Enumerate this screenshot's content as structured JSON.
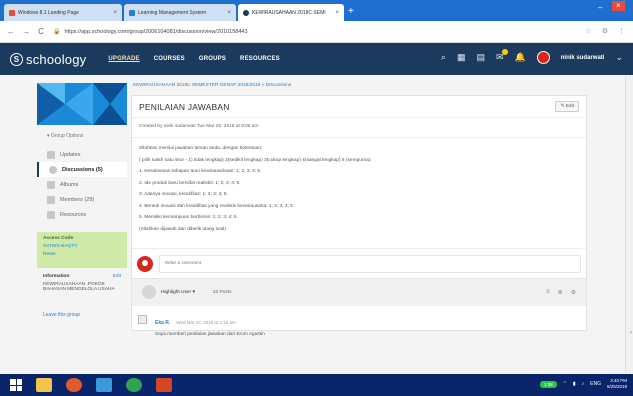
{
  "browser": {
    "tabs": [
      {
        "label": "Windows 8.1 Landing Page",
        "color": "#e74c3c",
        "active": false
      },
      {
        "label": "Learning Management System",
        "color": "#2b7fc9",
        "active": false
      },
      {
        "label": "KEWIRAUSAHAAN 2018C SEMI",
        "color": "#1c3a5e",
        "active": true
      }
    ],
    "url": "https://app.schoology.com/group/2006104081/discussion/view/2010158443",
    "nav_icons": [
      "back-icon",
      "forward-icon",
      "reload-icon"
    ]
  },
  "header": {
    "logo_text": "schoology",
    "nav": [
      "UPGRADE",
      "COURSES",
      "GROUPS",
      "RESOURCES"
    ],
    "username": "ninik sudarwati"
  },
  "sidebar": {
    "group_options": "Group Options",
    "items": [
      {
        "label": "Updates",
        "active": false
      },
      {
        "label": "Discussions (5)",
        "active": true
      },
      {
        "label": "Albums",
        "active": false
      },
      {
        "label": "Members (28)",
        "active": false
      },
      {
        "label": "Resources",
        "active": false
      }
    ],
    "access_code_title": "Access Code",
    "access_code": "X4TWX-BAQTV",
    "reset": "Reset",
    "info_title": "Information",
    "info_edit": "Edit",
    "info_text": "KEWIRAUSAHAAN .POKOK BAHASAN MENGELOLA USAHA",
    "leave": "Leave this group"
  },
  "main": {
    "breadcrumb": "KEWIRAUSAHAAN 2018C SEMESTER GENAP 2018/2019 » Discussions",
    "title": "PENILAIAN JAWABAN",
    "edit": "Edit",
    "meta": "Created by ninik sudarwati Tue Mar 26, 2019 at 9:05 am",
    "body": [
      "Silahkan menilai jawaban teman anda, dengan ketentuan:",
      "( pilih salah satu skor - 1) tidak lengkap) 2(sedikit lengkap) 3(cukup lengkap) 4(sangat lengkap) 5 (sempurna).",
      "1. Kesuksesan tahapan teori kewirausahaan: 1; 2; 3; 4; 5.",
      "2. Ide produk baru bersifat realistis: 1; 2; 3; 4; 5.",
      "3. Adanya inovasi, kreatifitas: 1; 2; 3; 4; 5.",
      "4. Bentuk inovasi dan kreatifitas yang realistis berwirausaha: 1; 2; 3; 4; 5.",
      "5. Memiliki kemampuan berbisnis: 1; 2; 3; 4; 5.",
      "(Silahkan dijawab dan dibetik ulang soal)"
    ],
    "comment_placeholder": "Write a comment",
    "filter_label": "Highlight User ▾",
    "posts_count": "23 Posts",
    "post": {
      "author": "Eka R.",
      "time": "Wed Mar 27, 2019 at 1:15 am",
      "text": "Saya memberi penilaian jawaban dari Erum Agustin"
    }
  },
  "taskbar": {
    "tray_pill": "1:38",
    "time": "3:40 PM",
    "date": "6/25/2019",
    "lang": "ENG"
  }
}
